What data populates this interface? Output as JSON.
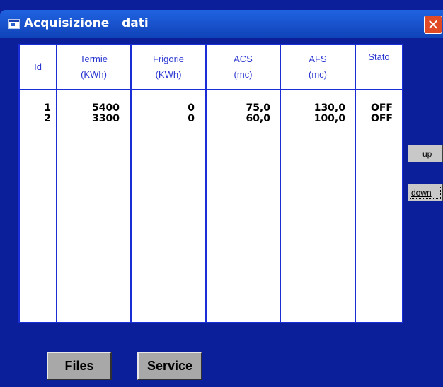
{
  "window": {
    "title": "Acquisizione   dati",
    "close_glyph": "✕"
  },
  "table": {
    "columns": [
      {
        "line1": "Id",
        "line2": ""
      },
      {
        "line1": "Termie",
        "line2": "(KWh)"
      },
      {
        "line1": "Frigorie",
        "line2": "(KWh)"
      },
      {
        "line1": "ACS",
        "line2": "(mc)"
      },
      {
        "line1": "AFS",
        "line2": "(mc)"
      },
      {
        "line1": "Stato",
        "line2": ""
      }
    ],
    "rows": [
      {
        "id": "1",
        "termie": "5400",
        "frigorie": "0",
        "acs": "75,0",
        "afs": "130,0",
        "stato": "OFF"
      },
      {
        "id": "2",
        "termie": "3300",
        "frigorie": "0",
        "acs": "60,0",
        "afs": "100,0",
        "stato": "OFF"
      }
    ]
  },
  "buttons": {
    "up": "up",
    "down": "down",
    "files": "Files",
    "service": "Service"
  },
  "colors": {
    "window_background": "#0a1f99",
    "grid_lines": "#1a2ed8",
    "header_text": "#2a36d0",
    "close_button": "#e04a24"
  }
}
